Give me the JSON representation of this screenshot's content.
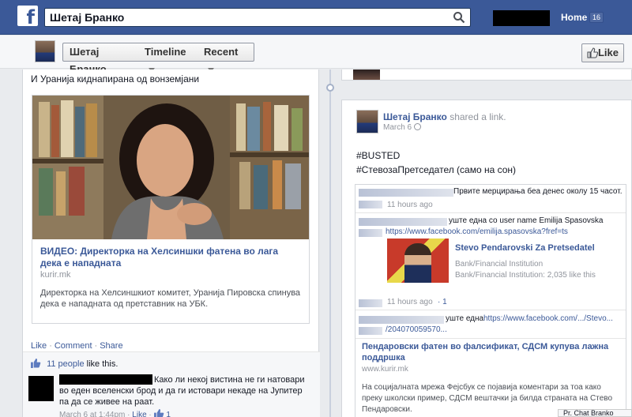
{
  "topbar": {
    "logo": "f",
    "search_value": "Шетај Бранко",
    "home_label": "Home",
    "home_count": "16"
  },
  "subbar": {
    "crumb_name": "Шетај Бранко",
    "crumb_timeline": "Timeline",
    "crumb_recent": "Recent",
    "like_label": "Like"
  },
  "left_post": {
    "text": "И Уранија киднапирана од вонземјани",
    "share": {
      "title": "ВИДЕО: Директорка на Хелсиншки фатена во лага дека е нападната",
      "domain": "kurir.mk",
      "description": "Директорка на Хелсиншкиот комитет, Уранија Пировска спинува дека е нападната од претставник на УБК."
    },
    "actions": {
      "like": "Like",
      "comment": "Comment",
      "share": "Share",
      "sep": "·"
    },
    "likes": {
      "count_text": "11 people",
      "suffix": "like this."
    },
    "comment": {
      "text": "Како ли некој вистина не ги натовари во еден вселенски брод и да ги истовари некаде на Јупитер па да се живее на раат.",
      "date": "March 6 at 1:44pm",
      "like": "Like",
      "likes": "1"
    }
  },
  "right_post": {
    "author": "Шетај Бранко",
    "verb": "shared a link.",
    "date": "March 6",
    "line1": "#BUSTED",
    "line2": "#СтевозаПретседател (само на сон)",
    "feed": {
      "item1_text": "Првите мерцирања беа денес околу 15 часот.",
      "item1_time": "11 hours ago",
      "item2_text": "уште една со user name Emilija Spasovska",
      "item2_url": "https://www.facebook.com/emilija.spasovska?fref=ts",
      "item2_title": "Stevo Pendarovski Za Pretsedatel",
      "item2_cat1": "Bank/Financial Institution",
      "item2_cat2": "Bank/Financial Institution: 2,035 like this",
      "item2_time": "11 hours ago",
      "item2_likes": "1",
      "item3_text": "уште една",
      "item3_url": "https://www.facebook.com/.../Stevo...",
      "item3_url2": "/204070059570...",
      "item4_title": "Пендаровски фатен во фалсификат, СДСМ купува лажна поддршка",
      "item4_domain": "www.kurir.mk",
      "item4_desc": "На социјалната мрежа Фејсбук се појавија коментари за тоа како преку школски пример, СДСМ вештачки ја билда страната на Стево Пендаровски."
    }
  },
  "corner_badge": "Pr. Chat Branko"
}
